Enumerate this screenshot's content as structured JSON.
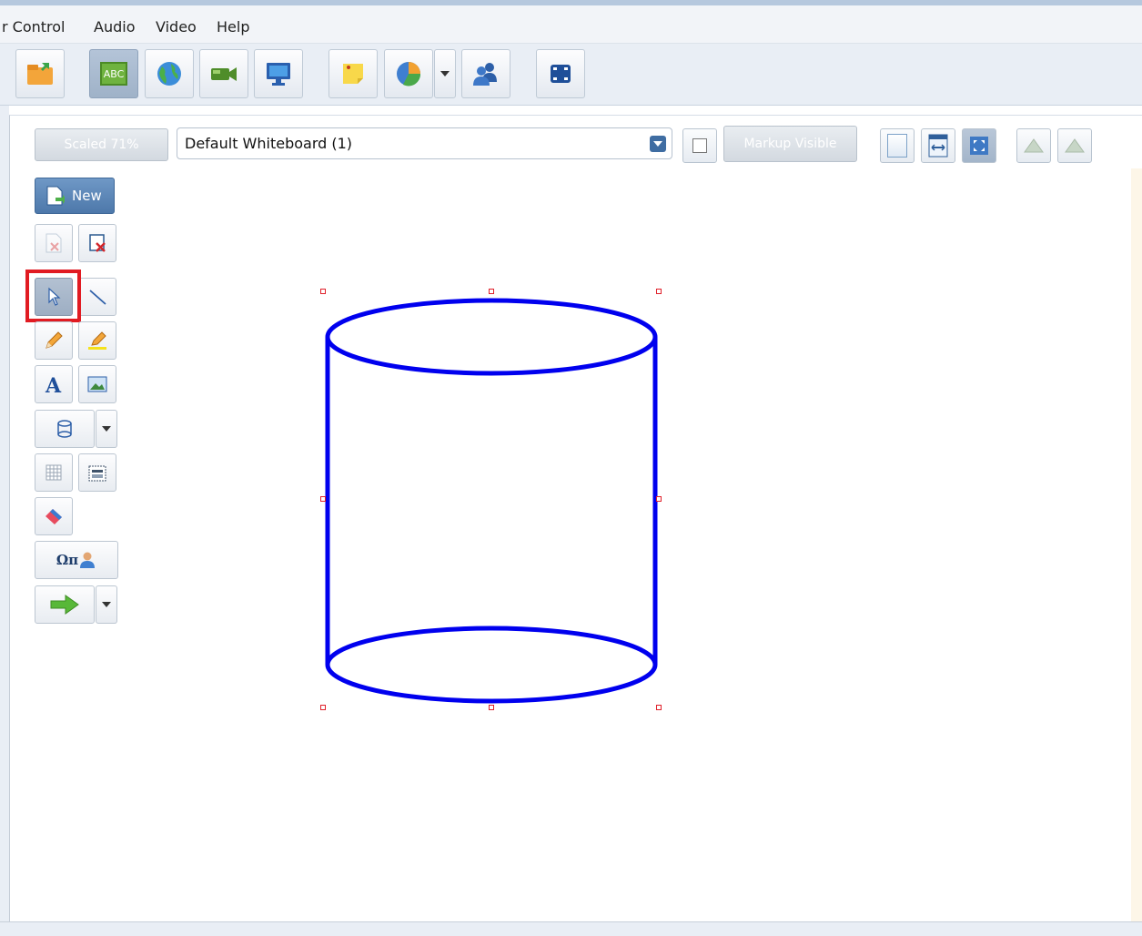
{
  "menubar": {
    "items": [
      {
        "label": "r Control"
      },
      {
        "label": "Audio"
      },
      {
        "label": "Video"
      },
      {
        "label": "Help"
      }
    ]
  },
  "toolbar": {
    "buttons": [
      {
        "icon": "folder-share-icon"
      },
      {
        "icon": "whiteboard-abc-icon",
        "label": "ABC",
        "active": true
      },
      {
        "icon": "globe-icon"
      },
      {
        "icon": "video-camera-icon"
      },
      {
        "icon": "desktop-share-icon"
      },
      {
        "icon": "sticky-note-icon"
      },
      {
        "icon": "pie-chart-icon"
      },
      {
        "icon": "users-icon"
      },
      {
        "icon": "fullscreen-icon"
      }
    ]
  },
  "subtoolbar": {
    "scale_label": "Scaled 71%",
    "whiteboard_select": "Default Whiteboard (1)",
    "markup_label": "Markup Visible"
  },
  "tools": {
    "new_label": "New",
    "symbols_label": "Ωπ"
  },
  "colors": {
    "shape_stroke": "#0000ee",
    "selection_handles": "#e0202a",
    "highlight": "#e11b22",
    "accent": "#4d78aa"
  }
}
